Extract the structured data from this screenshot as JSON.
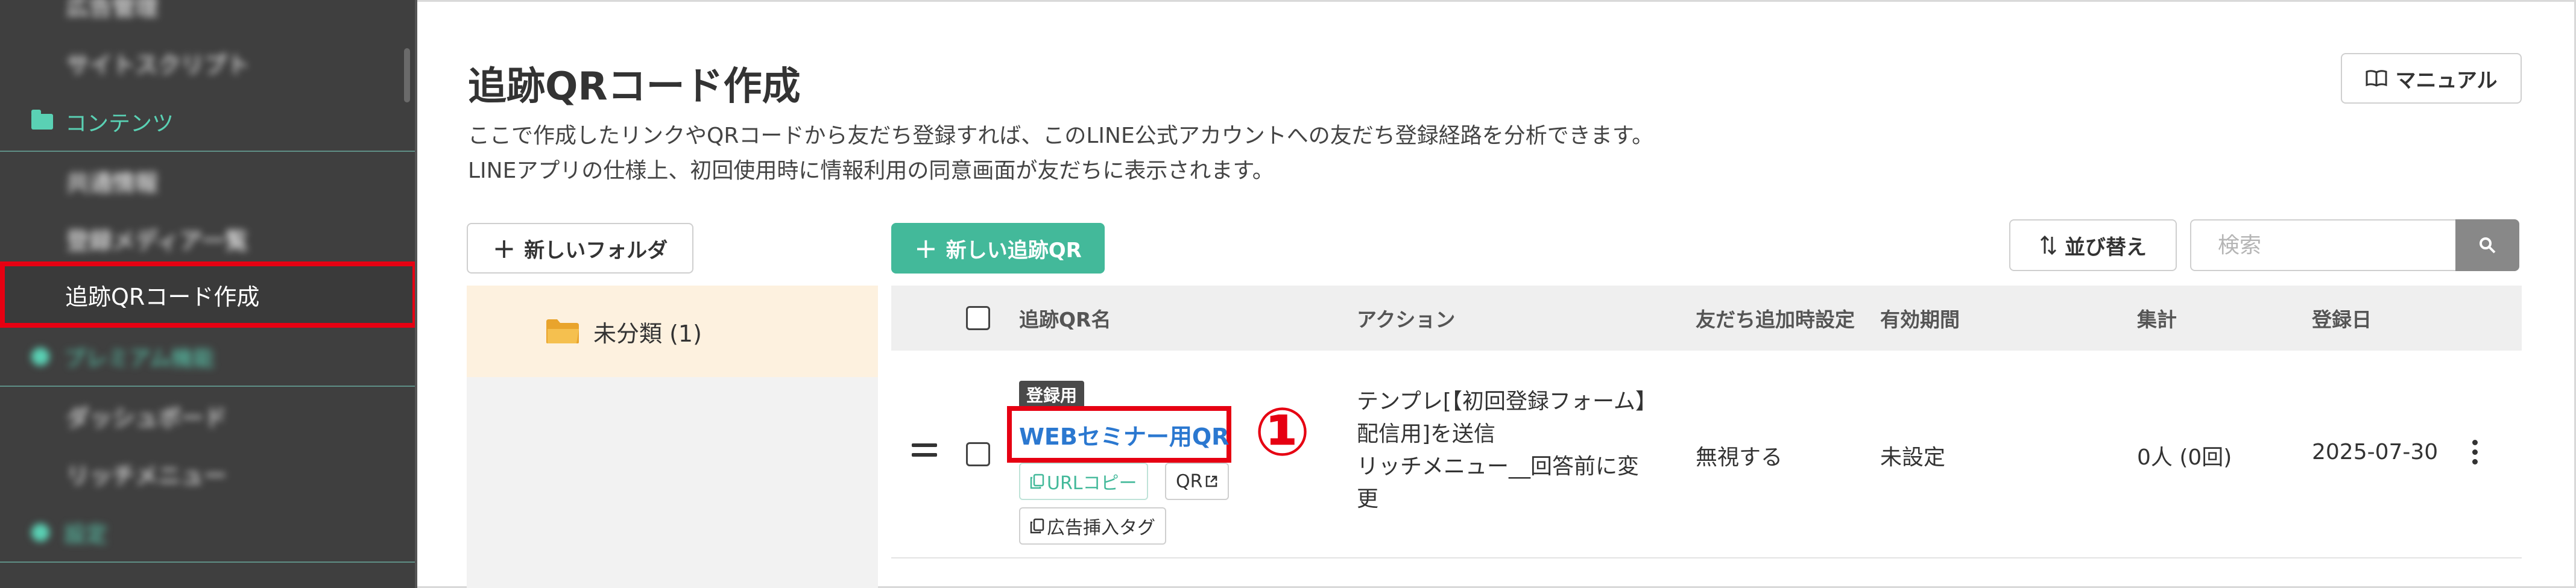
{
  "sidebar": {
    "items": [
      {
        "label": "広告管理"
      },
      {
        "label": "サイトスクリプト"
      },
      {
        "label": "コンテンツ"
      },
      {
        "label": "共通情報"
      },
      {
        "label": "登録メディア一覧"
      },
      {
        "label": "追跡QRコード作成"
      },
      {
        "label": "プレミアム機能"
      },
      {
        "label": "ダッシュボード"
      },
      {
        "label": "リッチメニュー"
      },
      {
        "label": "設定"
      }
    ]
  },
  "header": {
    "title": "追跡QRコード作成",
    "description_line1": "ここで作成したリンクやQRコードから友だち登録すれば、このLINE公式アカウントへの友だち登録経路を分析できます。",
    "description_line2": "LINEアプリの仕様上、初回使用時に情報利用の同意画面が友だちに表示されます。",
    "manual_label": "マニュアル"
  },
  "toolbar": {
    "new_folder_label": "新しいフォルダ",
    "new_qr_label": "新しい追跡QR",
    "sort_label": "並び替え",
    "search_placeholder": "検索"
  },
  "folders": [
    {
      "label": "未分類 (1)"
    }
  ],
  "table": {
    "headers": {
      "name": "追跡QR名",
      "action": "アクション",
      "friend_setting": "友だち追加時設定",
      "validity": "有効期間",
      "count": "集計",
      "registered": "登録日"
    },
    "rows": [
      {
        "badge": "登録用",
        "name": "WEBセミナー用QR",
        "annotation": "①",
        "url_copy": "URLコピー",
        "qr": "QR",
        "ad_tag": "広告挿入タグ",
        "action": "テンプレ[【初回登録フォーム】\n配信用]を送信\nリッチメニュー__回答前に変\n更",
        "friend_setting": "無視する",
        "validity": "未設定",
        "count": "0人 (0回)",
        "registered": "2025-07-30"
      }
    ]
  },
  "colors": {
    "accent_green": "#43b99a",
    "highlight_red": "#e60012",
    "link_blue": "#2b78d0",
    "sidebar_bg": "#3f3f3f"
  }
}
